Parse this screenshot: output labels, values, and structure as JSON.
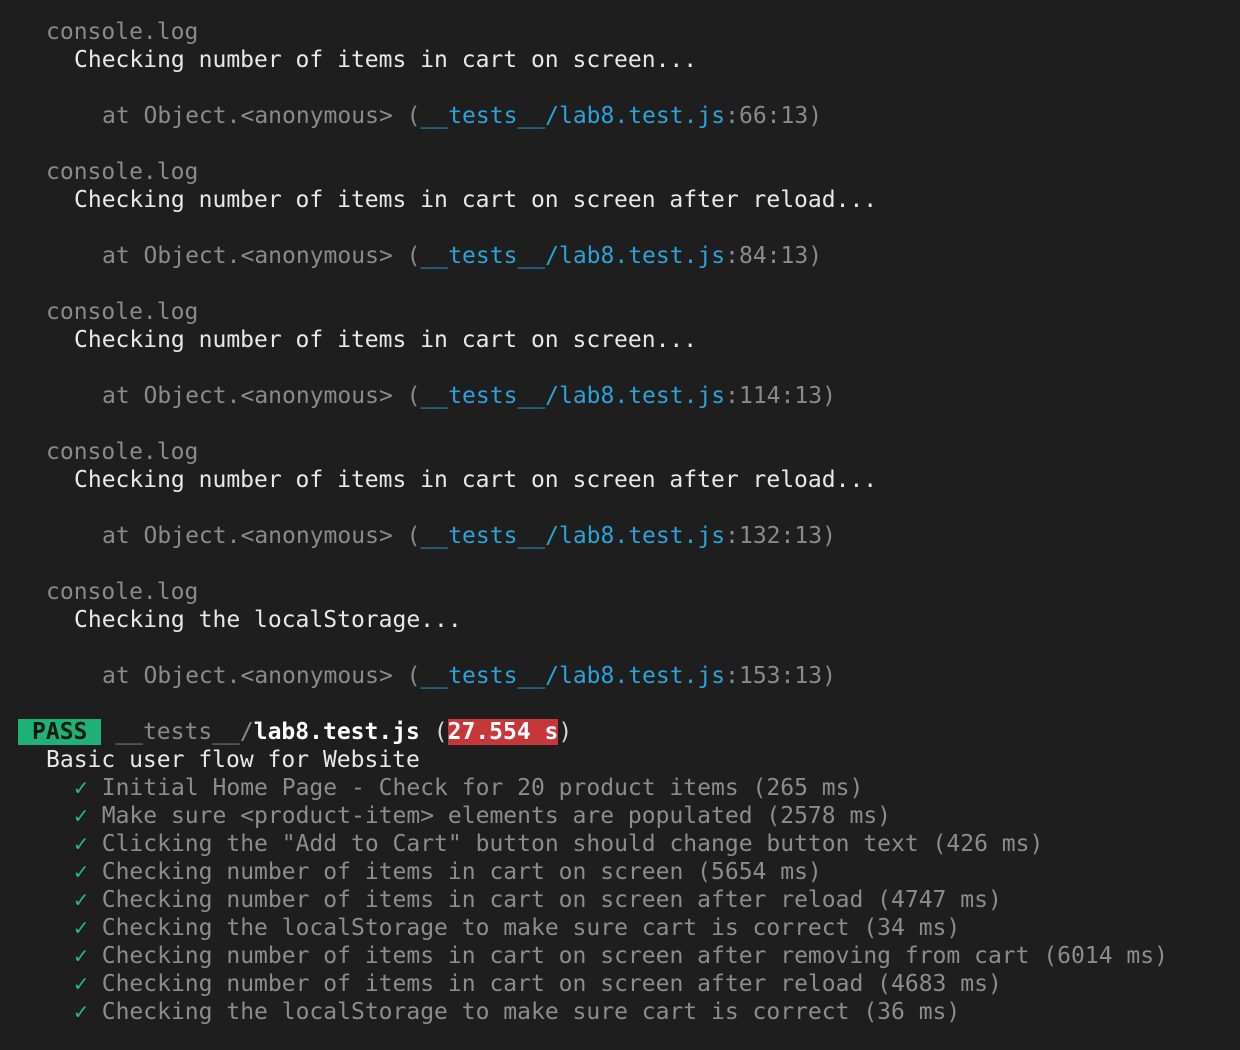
{
  "log_entries": [
    {
      "label": "console.log",
      "message": "Checking number of items in cart on screen...",
      "at_prefix": "at Object.<anonymous> (",
      "file": "__tests__/lab8.test.js",
      "location": ":66:13",
      "at_suffix": ")"
    },
    {
      "label": "console.log",
      "message": "Checking number of items in cart on screen after reload...",
      "at_prefix": "at Object.<anonymous> (",
      "file": "__tests__/lab8.test.js",
      "location": ":84:13",
      "at_suffix": ")"
    },
    {
      "label": "console.log",
      "message": "Checking number of items in cart on screen...",
      "at_prefix": "at Object.<anonymous> (",
      "file": "__tests__/lab8.test.js",
      "location": ":114:13",
      "at_suffix": ")"
    },
    {
      "label": "console.log",
      "message": "Checking number of items in cart on screen after reload...",
      "at_prefix": "at Object.<anonymous> (",
      "file": "__tests__/lab8.test.js",
      "location": ":132:13",
      "at_suffix": ")"
    },
    {
      "label": "console.log",
      "message": "Checking the localStorage...",
      "at_prefix": "at Object.<anonymous> (",
      "file": "__tests__/lab8.test.js",
      "location": ":153:13",
      "at_suffix": ")"
    }
  ],
  "result": {
    "status": "PASS",
    "dir": "__tests__/",
    "file": "lab8.test.js",
    "open_paren": "(",
    "duration": "27.554 s",
    "close_paren": ")",
    "suite": "Basic user flow for Website"
  },
  "tests": [
    {
      "check": "✓",
      "name": "Initial Home Page - Check for 20 product items (265 ms)"
    },
    {
      "check": "✓",
      "name": "Make sure <product-item> elements are populated (2578 ms)"
    },
    {
      "check": "✓",
      "name": "Clicking the \"Add to Cart\" button should change button text (426 ms)"
    },
    {
      "check": "✓",
      "name": "Checking number of items in cart on screen (5654 ms)"
    },
    {
      "check": "✓",
      "name": "Checking number of items in cart on screen after reload (4747 ms)"
    },
    {
      "check": "✓",
      "name": "Checking the localStorage to make sure cart is correct (34 ms)"
    },
    {
      "check": "✓",
      "name": "Checking number of items in cart on screen after removing from cart (6014 ms)"
    },
    {
      "check": "✓",
      "name": "Checking number of items in cart on screen after reload (4683 ms)"
    },
    {
      "check": "✓",
      "name": "Checking the localStorage to make sure cart is correct (36 ms)"
    }
  ],
  "colors": {
    "background": "#1e1e1e",
    "pass": "#1fb277",
    "slow": "#c7373a",
    "link": "#2aa3d8"
  }
}
